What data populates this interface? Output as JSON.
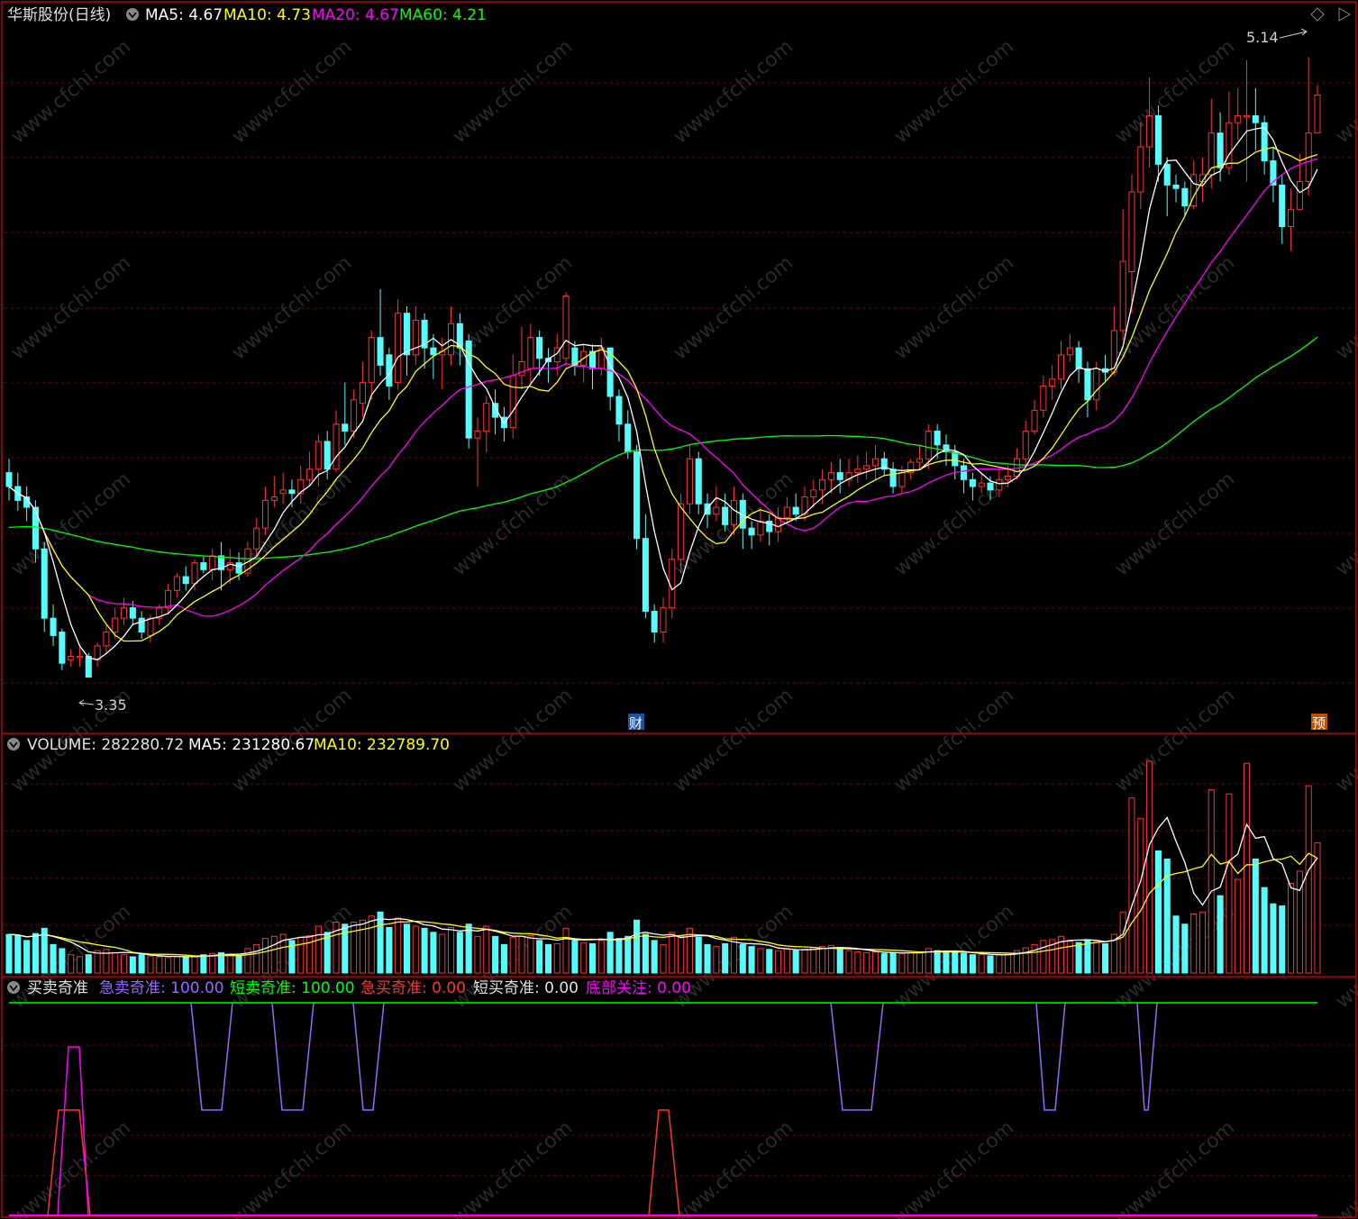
{
  "header": {
    "stock_name": "华斯股份(日线)",
    "ma5": "MA5: 4.67",
    "ma10": "MA10: 4.73",
    "ma20": "MA20: 4.67",
    "ma60": "MA60: 4.21",
    "high_label": "5.14",
    "low_label": "3.35",
    "marker_cai": "财",
    "marker_yu": "预"
  },
  "volume_header": {
    "label": "VOLUME: 282280.72",
    "ma5": "MA5: 231280.67",
    "ma10": "MA10: 232789.70"
  },
  "indicator_header": {
    "title": "买卖奇准",
    "ji_mai": "急卖奇准: 100.00",
    "duan_mai": "短卖奇准: 100.00",
    "ji_mai_buy": "急买奇准: 0.00",
    "duan_mai_buy": "短买奇准: 0.00",
    "di_bu": "底部关注: 0.00"
  },
  "watermark": "www.cfchi.com",
  "colors": {
    "up": "#ff3232",
    "down": "#54fcfc",
    "ma5": "#ffffff",
    "ma10": "#ffff00",
    "ma20": "#ff00ff",
    "ma60": "#00ff00",
    "grid": "#7a0000",
    "border": "#c00000",
    "ji_sell": "#9966ff",
    "short_sell": "#00ff00",
    "ji_buy": "#ff3232",
    "di_bu": "#ff00ff"
  },
  "chart_data": {
    "type": "candlestick",
    "price_range": [
      3.25,
      5.2
    ],
    "volume_max": 520000,
    "candles": [
      [
        3.94,
        3.9,
        3.98,
        3.86,
        95000
      ],
      [
        3.9,
        3.86,
        3.94,
        3.83,
        92000
      ],
      [
        3.87,
        3.84,
        3.9,
        3.8,
        80000
      ],
      [
        3.84,
        3.72,
        3.86,
        3.68,
        97000
      ],
      [
        3.72,
        3.52,
        3.74,
        3.48,
        110000
      ],
      [
        3.52,
        3.47,
        3.56,
        3.44,
        70000
      ],
      [
        3.48,
        3.39,
        3.49,
        3.37,
        60000
      ],
      [
        3.4,
        3.41,
        3.43,
        3.38,
        45000
      ],
      [
        3.41,
        3.41,
        3.44,
        3.38,
        40000
      ],
      [
        3.41,
        3.35,
        3.42,
        3.35,
        45000
      ],
      [
        3.4,
        3.44,
        3.45,
        3.38,
        55000
      ],
      [
        3.44,
        3.48,
        3.5,
        3.42,
        58000
      ],
      [
        3.48,
        3.52,
        3.55,
        3.46,
        50000
      ],
      [
        3.52,
        3.55,
        3.58,
        3.5,
        45000
      ],
      [
        3.55,
        3.52,
        3.57,
        3.5,
        40000
      ],
      [
        3.52,
        3.48,
        3.54,
        3.46,
        45000
      ],
      [
        3.47,
        3.52,
        3.53,
        3.45,
        42000
      ],
      [
        3.52,
        3.55,
        3.56,
        3.5,
        40000
      ],
      [
        3.55,
        3.6,
        3.62,
        3.53,
        38000
      ],
      [
        3.6,
        3.64,
        3.65,
        3.58,
        40000
      ],
      [
        3.64,
        3.62,
        3.67,
        3.6,
        40000
      ],
      [
        3.62,
        3.68,
        3.69,
        3.6,
        42000
      ],
      [
        3.68,
        3.66,
        3.7,
        3.65,
        45000
      ],
      [
        3.66,
        3.7,
        3.72,
        3.63,
        48000
      ],
      [
        3.7,
        3.66,
        3.74,
        3.6,
        50000
      ],
      [
        3.66,
        3.68,
        3.72,
        3.62,
        45000
      ],
      [
        3.68,
        3.65,
        3.71,
        3.63,
        42000
      ],
      [
        3.65,
        3.72,
        3.74,
        3.64,
        60000
      ],
      [
        3.72,
        3.78,
        3.81,
        3.7,
        70000
      ],
      [
        3.78,
        3.86,
        3.9,
        3.76,
        85000
      ],
      [
        3.86,
        3.87,
        3.93,
        3.84,
        90000
      ],
      [
        3.88,
        3.89,
        3.94,
        3.85,
        95000
      ],
      [
        3.89,
        3.88,
        3.92,
        3.84,
        80000
      ],
      [
        3.88,
        3.92,
        3.96,
        3.85,
        88000
      ],
      [
        3.92,
        3.95,
        4.0,
        3.9,
        92000
      ],
      [
        3.95,
        4.03,
        4.05,
        3.9,
        115000
      ],
      [
        4.03,
        3.95,
        4.06,
        3.92,
        100000
      ],
      [
        3.95,
        4.08,
        4.12,
        3.94,
        125000
      ],
      [
        4.08,
        4.06,
        4.2,
        4.02,
        120000
      ],
      [
        4.06,
        4.15,
        4.18,
        4.04,
        125000
      ],
      [
        4.14,
        4.2,
        4.26,
        4.1,
        130000
      ],
      [
        4.2,
        4.33,
        4.35,
        4.15,
        140000
      ],
      [
        4.33,
        4.25,
        4.47,
        4.22,
        150000
      ],
      [
        4.28,
        4.19,
        4.3,
        4.15,
        112000
      ],
      [
        4.2,
        4.4,
        4.44,
        4.18,
        135000
      ],
      [
        4.4,
        4.28,
        4.42,
        4.22,
        120000
      ],
      [
        4.28,
        4.38,
        4.42,
        4.25,
        115000
      ],
      [
        4.38,
        4.3,
        4.4,
        4.24,
        110000
      ],
      [
        4.3,
        4.28,
        4.34,
        4.21,
        100000
      ],
      [
        4.28,
        4.29,
        4.33,
        4.18,
        95000
      ],
      [
        4.28,
        4.37,
        4.42,
        4.25,
        112000
      ],
      [
        4.37,
        4.3,
        4.4,
        4.25,
        100000
      ],
      [
        4.32,
        4.04,
        4.34,
        4.01,
        120000
      ],
      [
        4.04,
        4.06,
        4.1,
        3.9,
        90000
      ],
      [
        4.06,
        4.14,
        4.16,
        4.0,
        115000
      ],
      [
        4.14,
        4.1,
        4.18,
        4.05,
        90000
      ],
      [
        4.1,
        4.07,
        4.13,
        4.03,
        70000
      ],
      [
        4.07,
        4.22,
        4.28,
        4.04,
        88000
      ],
      [
        4.22,
        4.26,
        4.36,
        4.18,
        90000
      ],
      [
        4.24,
        4.33,
        4.37,
        4.2,
        92000
      ],
      [
        4.33,
        4.27,
        4.35,
        4.22,
        80000
      ],
      [
        4.27,
        4.26,
        4.3,
        4.2,
        70000
      ],
      [
        4.26,
        4.3,
        4.34,
        4.22,
        72000
      ],
      [
        4.27,
        4.45,
        4.46,
        4.25,
        110000
      ],
      [
        4.3,
        4.25,
        4.32,
        4.22,
        80000
      ],
      [
        4.25,
        4.29,
        4.31,
        4.2,
        75000
      ],
      [
        4.29,
        4.24,
        4.31,
        4.18,
        72000
      ],
      [
        4.24,
        4.3,
        4.33,
        4.22,
        80000
      ],
      [
        4.3,
        4.16,
        4.3,
        4.12,
        100000
      ],
      [
        4.16,
        4.08,
        4.18,
        4.03,
        85000
      ],
      [
        4.08,
        4.0,
        4.12,
        3.98,
        90000
      ],
      [
        4.0,
        3.75,
        4.02,
        3.72,
        130000
      ],
      [
        3.75,
        3.54,
        3.82,
        3.52,
        95000
      ],
      [
        3.54,
        3.48,
        3.56,
        3.45,
        80000
      ],
      [
        3.48,
        3.55,
        3.58,
        3.45,
        70000
      ],
      [
        3.55,
        3.69,
        3.72,
        3.52,
        100000
      ],
      [
        3.69,
        3.85,
        3.88,
        3.65,
        90000
      ],
      [
        3.85,
        3.98,
        4.02,
        3.82,
        110000
      ],
      [
        3.98,
        3.85,
        4.0,
        3.82,
        88000
      ],
      [
        3.85,
        3.82,
        3.88,
        3.78,
        70000
      ],
      [
        3.82,
        3.84,
        3.9,
        3.8,
        65000
      ],
      [
        3.84,
        3.79,
        3.88,
        3.77,
        72000
      ],
      [
        3.79,
        3.86,
        3.9,
        3.76,
        88000
      ],
      [
        3.86,
        3.78,
        3.88,
        3.72,
        70000
      ],
      [
        3.78,
        3.76,
        3.8,
        3.72,
        65000
      ],
      [
        3.76,
        3.8,
        3.84,
        3.74,
        60000
      ],
      [
        3.8,
        3.77,
        3.82,
        3.73,
        58000
      ],
      [
        3.77,
        3.81,
        3.84,
        3.74,
        55000
      ],
      [
        3.81,
        3.84,
        3.87,
        3.79,
        60000
      ],
      [
        3.84,
        3.82,
        3.88,
        3.8,
        55000
      ],
      [
        3.82,
        3.87,
        3.9,
        3.8,
        58000
      ],
      [
        3.87,
        3.89,
        3.92,
        3.84,
        62000
      ],
      [
        3.89,
        3.92,
        3.95,
        3.85,
        65000
      ],
      [
        3.92,
        3.94,
        3.97,
        3.88,
        68000
      ],
      [
        3.94,
        3.92,
        3.98,
        3.88,
        60000
      ],
      [
        3.92,
        3.94,
        3.98,
        3.9,
        55000
      ],
      [
        3.94,
        3.95,
        3.99,
        3.91,
        52000
      ],
      [
        3.95,
        3.96,
        4.0,
        3.92,
        50000
      ],
      [
        3.96,
        3.98,
        4.02,
        3.92,
        52000
      ],
      [
        3.98,
        3.95,
        4.0,
        3.93,
        48000
      ],
      [
        3.95,
        3.9,
        3.97,
        3.88,
        50000
      ],
      [
        3.9,
        3.94,
        3.96,
        3.88,
        48000
      ],
      [
        3.94,
        3.97,
        3.98,
        3.92,
        50000
      ],
      [
        3.97,
        3.98,
        4.02,
        3.95,
        52000
      ],
      [
        3.98,
        4.06,
        4.08,
        3.95,
        60000
      ],
      [
        4.06,
        4.02,
        4.08,
        3.98,
        55000
      ],
      [
        4.02,
        4.0,
        4.05,
        3.96,
        52000
      ],
      [
        4.0,
        3.96,
        4.02,
        3.92,
        50000
      ],
      [
        3.96,
        3.92,
        3.98,
        3.88,
        48000
      ],
      [
        3.92,
        3.9,
        3.94,
        3.86,
        45000
      ],
      [
        3.9,
        3.91,
        3.94,
        3.88,
        45000
      ],
      [
        3.91,
        3.89,
        3.93,
        3.86,
        42000
      ],
      [
        3.89,
        3.92,
        3.95,
        3.87,
        45000
      ],
      [
        3.92,
        3.93,
        3.96,
        3.9,
        48000
      ],
      [
        3.93,
        3.98,
        4.01,
        3.92,
        55000
      ],
      [
        3.98,
        4.06,
        4.09,
        3.96,
        62000
      ],
      [
        4.06,
        4.12,
        4.15,
        4.05,
        70000
      ],
      [
        4.12,
        4.19,
        4.22,
        4.1,
        80000
      ],
      [
        4.19,
        4.21,
        4.25,
        4.15,
        82000
      ],
      [
        4.21,
        4.28,
        4.32,
        4.18,
        90000
      ],
      [
        4.28,
        4.3,
        4.34,
        4.26,
        78000
      ],
      [
        4.3,
        4.24,
        4.32,
        4.2,
        75000
      ],
      [
        4.24,
        4.15,
        4.26,
        4.1,
        82000
      ],
      [
        4.15,
        4.24,
        4.26,
        4.12,
        78000
      ],
      [
        4.24,
        4.23,
        4.28,
        4.2,
        72000
      ],
      [
        4.23,
        4.35,
        4.42,
        4.22,
        95000
      ],
      [
        4.35,
        4.55,
        4.7,
        4.32,
        150000
      ],
      [
        4.52,
        4.75,
        4.8,
        4.4,
        430000
      ],
      [
        4.75,
        4.88,
        4.95,
        4.7,
        380000
      ],
      [
        4.88,
        4.97,
        5.08,
        4.82,
        520000
      ],
      [
        4.97,
        4.83,
        5.0,
        4.78,
        300000
      ],
      [
        4.83,
        4.77,
        4.85,
        4.68,
        280000
      ],
      [
        4.77,
        4.76,
        4.8,
        4.72,
        140000
      ],
      [
        4.76,
        4.71,
        4.78,
        4.68,
        120000
      ],
      [
        4.71,
        4.8,
        4.84,
        4.7,
        145000
      ],
      [
        4.78,
        4.8,
        4.85,
        4.72,
        150000
      ],
      [
        4.8,
        4.92,
        5.02,
        4.76,
        450000
      ],
      [
        4.92,
        4.82,
        4.98,
        4.78,
        190000
      ],
      [
        4.82,
        4.95,
        5.04,
        4.8,
        440000
      ],
      [
        4.95,
        4.97,
        5.05,
        4.9,
        230000
      ],
      [
        4.97,
        4.97,
        5.13,
        4.78,
        515000
      ],
      [
        4.97,
        4.95,
        5.05,
        4.87,
        280000
      ],
      [
        4.95,
        4.84,
        4.97,
        4.8,
        210000
      ],
      [
        4.84,
        4.77,
        4.88,
        4.72,
        170000
      ],
      [
        4.77,
        4.65,
        4.8,
        4.6,
        165000
      ],
      [
        4.65,
        4.7,
        4.76,
        4.58,
        220000
      ],
      [
        4.7,
        4.78,
        4.86,
        4.72,
        250000
      ],
      [
        4.78,
        4.92,
        5.14,
        4.74,
        460000
      ],
      [
        4.92,
        5.03,
        5.06,
        4.92,
        320000
      ]
    ]
  }
}
